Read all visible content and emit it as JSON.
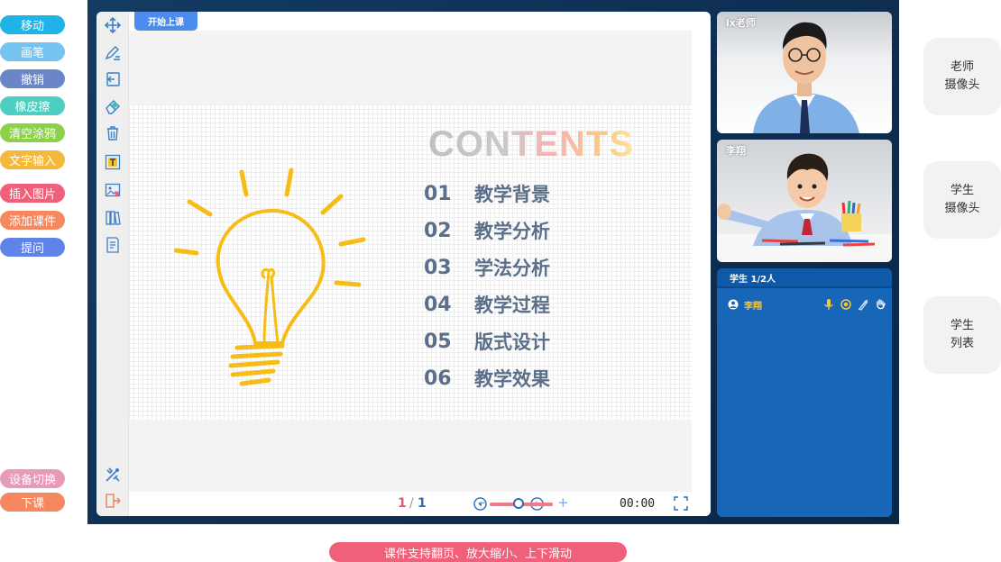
{
  "left_callouts": [
    {
      "label": "移动",
      "color": "#1fb4e8"
    },
    {
      "label": "画笔",
      "color": "#75c3f0"
    },
    {
      "label": "撤销",
      "color": "#6a86c9"
    },
    {
      "label": "橡皮擦",
      "color": "#4ccfc0"
    },
    {
      "label": "清空涂鸦",
      "color": "#8dd04a"
    },
    {
      "label": "文字输入",
      "color": "#f4b93a"
    },
    {
      "label": "插入图片",
      "color": "#f0607a"
    },
    {
      "label": "添加课件",
      "color": "#f5885f"
    },
    {
      "label": "提问",
      "color": "#5f83e8"
    },
    {
      "label": "设备切换",
      "color": "#e89bb8"
    },
    {
      "label": "下课",
      "color": "#f5885f"
    }
  ],
  "right_callouts": [
    {
      "label": "老师\n摄像头"
    },
    {
      "label": "学生\n摄像头"
    },
    {
      "label": "学生\n列表"
    }
  ],
  "board": {
    "tab_label": "开始上课",
    "slide": {
      "title": "CONTENTS",
      "items": [
        {
          "num": "01",
          "text": "教学背景"
        },
        {
          "num": "02",
          "text": "教学分析"
        },
        {
          "num": "03",
          "text": "学法分析"
        },
        {
          "num": "04",
          "text": "教学过程"
        },
        {
          "num": "05",
          "text": "版式设计"
        },
        {
          "num": "06",
          "text": "教学效果"
        }
      ]
    },
    "controls": {
      "page_current": "1",
      "page_sep": "/",
      "page_total": "1",
      "zoom_minus": "−",
      "zoom_plus": "+",
      "zoom_level": 0.45,
      "timer": "00:00"
    }
  },
  "cameras": {
    "teacher_name": "lx老师",
    "student_name": "李翔"
  },
  "student_list": {
    "header": "学生 1/2人",
    "students": [
      {
        "name": "李翔"
      }
    ]
  },
  "caption": "课件支持翻页、放大缩小、上下滑动",
  "icons": {
    "tools": [
      "move-icon",
      "pen-icon",
      "undo-icon",
      "eraser-icon",
      "trash-icon",
      "text-icon",
      "image-icon",
      "courseware-icon",
      "question-icon",
      "device-switch-icon",
      "exit-icon"
    ]
  }
}
